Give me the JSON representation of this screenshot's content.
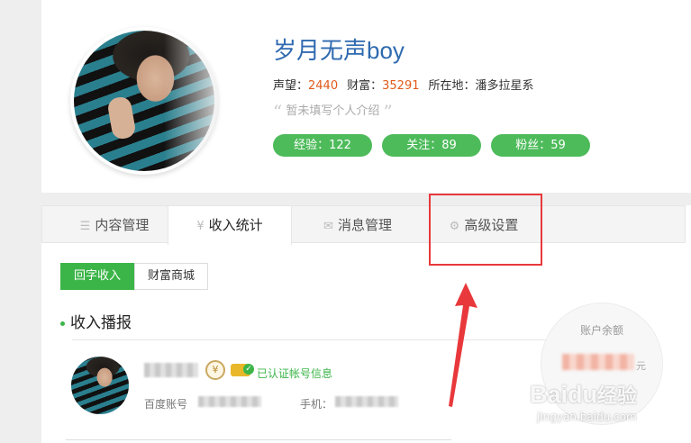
{
  "profile": {
    "username": "岁月无声boy",
    "reputation_label": "声望：",
    "reputation_value": "2440",
    "wealth_label": "财富：",
    "wealth_value": "35291",
    "location_label": "所在地：",
    "location_value": "潘多拉星系",
    "intro": "暂未填写个人介绍",
    "pills": [
      {
        "label": "经验：122"
      },
      {
        "label": "关注：89"
      },
      {
        "label": "粉丝：59"
      }
    ]
  },
  "tabs": [
    {
      "label": "内容管理",
      "icon": "list-icon"
    },
    {
      "label": "收入统计",
      "icon": "yen-icon"
    },
    {
      "label": "消息管理",
      "icon": "mail-icon"
    },
    {
      "label": "高级设置",
      "icon": "gear-icon"
    }
  ],
  "subtabs": [
    {
      "label": "回字收入"
    },
    {
      "label": "财富商城"
    }
  ],
  "section_title": "收入播报",
  "account": {
    "verified_text": "已认证帐号信息",
    "baidu_label": "百度账号",
    "phone_label": "手机：",
    "coin_symbol": "¥"
  },
  "balance": {
    "label": "账户余额",
    "unit": "元"
  },
  "watermark": {
    "brand": "Bai",
    "brand_paw": "du",
    "brand_suffix": "经验",
    "url": "jingyan.baidu.com"
  },
  "colors": {
    "accent_green": "#3cb548",
    "link_blue": "#2f6ab0",
    "number_orange": "#e05a1a",
    "highlight_red": "#e8383b"
  }
}
